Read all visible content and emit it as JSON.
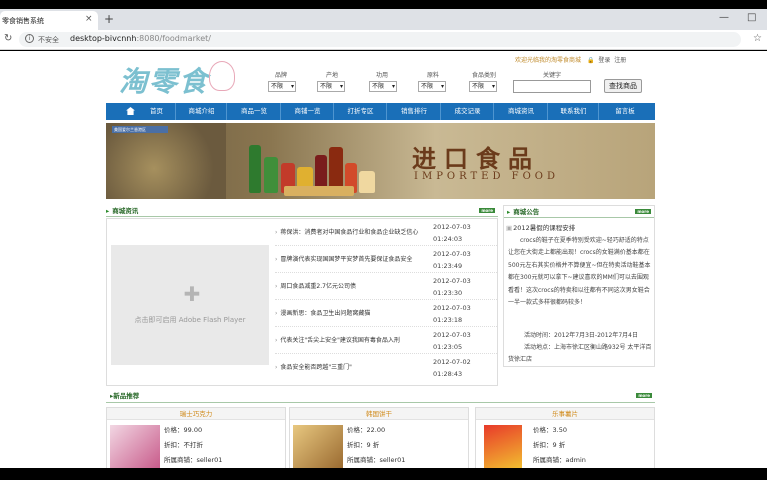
{
  "browser": {
    "tab_title": "零食销售系统",
    "tab_close": "×",
    "new_tab": "+",
    "security_label": "不安全",
    "url_host": "desktop-bivcnnh",
    "url_path": ":8080/foodmarket/",
    "window_controls": [
      "—",
      "□"
    ]
  },
  "header": {
    "logo_text": "淘零食",
    "welcome": "欢迎光临我的淘零食商城",
    "login_label": "登录",
    "register_label": "注册",
    "filters": [
      {
        "label": "品牌",
        "value": "不限"
      },
      {
        "label": "产地",
        "value": "不限"
      },
      {
        "label": "功用",
        "value": "不限"
      },
      {
        "label": "原料",
        "value": "不限"
      },
      {
        "label": "食品类别",
        "value": "不限"
      }
    ],
    "keyword_label": "关键字",
    "keyword_value": "",
    "search_button": "查找商品"
  },
  "nav": {
    "items": [
      "首页",
      "商城介绍",
      "商品一览",
      "商铺一览",
      "打折专区",
      "销售排行",
      "成交记录",
      "商城资讯",
      "联系我们",
      "留言板"
    ]
  },
  "banner": {
    "badge": "美国爱尔兰香港区",
    "title": "进口食品",
    "subtitle": "IMPORTED FOOD"
  },
  "news": {
    "heading": "商城资讯",
    "more": "more",
    "flash_text": "点击即可启用 Adobe Flash Player",
    "items": [
      {
        "title": "蒋保洪：消费者对中国食品行业和食品企业缺乏信心",
        "date": "2012-07-03",
        "time": "01:24:03"
      },
      {
        "title": "冒牌演代表实现国国梦平安梦首先要保证食品安全",
        "date": "2012-07-03",
        "time": "01:23:49"
      },
      {
        "title": "周口食品减重2.7亿元公司债",
        "date": "2012-07-03",
        "time": "01:23:30"
      },
      {
        "title": "漫画新思：食品卫生出问题窝藏猫",
        "date": "2012-07-03",
        "time": "01:23:18"
      },
      {
        "title": "代表关注\"舌尖上安全\"建议我国有毒食品入刑",
        "date": "2012-07-03",
        "time": "01:23:05"
      },
      {
        "title": "食品安全能否跨越\"三重门\"",
        "date": "2012-07-02",
        "time": "01:28:43"
      }
    ]
  },
  "notice": {
    "heading": "商城公告",
    "more": "more",
    "image_alt": "2012暑假的课程安排",
    "body": "crocs的鞋子在夏季特别受欢迎~轻巧舒适的特点让您在大街走上都能出现！crocs的女鞋满价基本都在500元左右其实价格并不算便宜~但在特卖活动鞋基本都在300元就可以拿下~建议喜欢的MM们可以去围观看看！这次crocs的特卖和以往都有不同这次男女鞋合一半一款式多样很都码较多！",
    "time_line": "活动时间：2012年7月3日-2012年7月4日",
    "place_line": "活动地点：上海市徐汇区衡山路932号 太平洋百货徐汇店"
  },
  "recommend": {
    "heading": "新品推荐",
    "products": [
      {
        "name": "瑞士巧克力",
        "price": "价格：99.00",
        "discount": "折扣：不打折",
        "seller": "所属商铺：seller01"
      },
      {
        "name": "韩国饼干",
        "price": "价格：22.00",
        "discount": "折扣：9 折",
        "seller": "所属商铺：seller01"
      },
      {
        "name": "乐事薯片",
        "price": "价格：3.50",
        "discount": "折扣：9 折",
        "seller": "所属商铺：admin"
      }
    ]
  },
  "colors": {
    "nav_blue": "#1a6fb8",
    "product_name": "#d08a1a",
    "section_green": "#2a6a2a"
  }
}
